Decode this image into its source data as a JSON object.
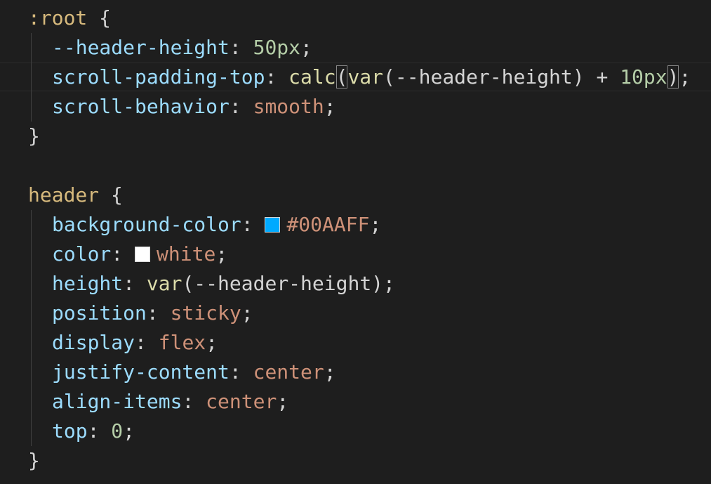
{
  "colors": {
    "background": "#1e1e1e",
    "selector": "#d7ba7d",
    "property": "#9cdcfe",
    "string": "#ce9178",
    "number": "#b5cea8",
    "function": "#dcdcaa",
    "punctuation": "#d4d4d4"
  },
  "lines": {
    "root_sel": ":root",
    "brace_open": " {",
    "brace_close": "}",
    "hh_prop": "--header-height",
    "hh_val": "50px",
    "spt_prop": "scroll-padding-top",
    "spt_fn": "calc",
    "spt_var": "var",
    "spt_arg": "(--header-height)",
    "spt_op": " + ",
    "spt_num": "10px",
    "sb_prop": "scroll-behavior",
    "sb_val": "smooth",
    "header_sel": "header",
    "bg_prop": "background-color",
    "bg_val": "#00AAFF",
    "bg_swatch": "#00AAFF",
    "color_prop": "color",
    "color_val": "white",
    "color_swatch": "#ffffff",
    "height_prop": "height",
    "height_fn": "var",
    "height_arg": "(--header-height)",
    "pos_prop": "position",
    "pos_val": "sticky",
    "disp_prop": "display",
    "disp_val": "flex",
    "jc_prop": "justify-content",
    "jc_val": "center",
    "ai_prop": "align-items",
    "ai_val": "center",
    "top_prop": "top",
    "top_val": "0",
    "colon": ": ",
    "semi": ";",
    "lparen": "(",
    "rparen": ")"
  }
}
